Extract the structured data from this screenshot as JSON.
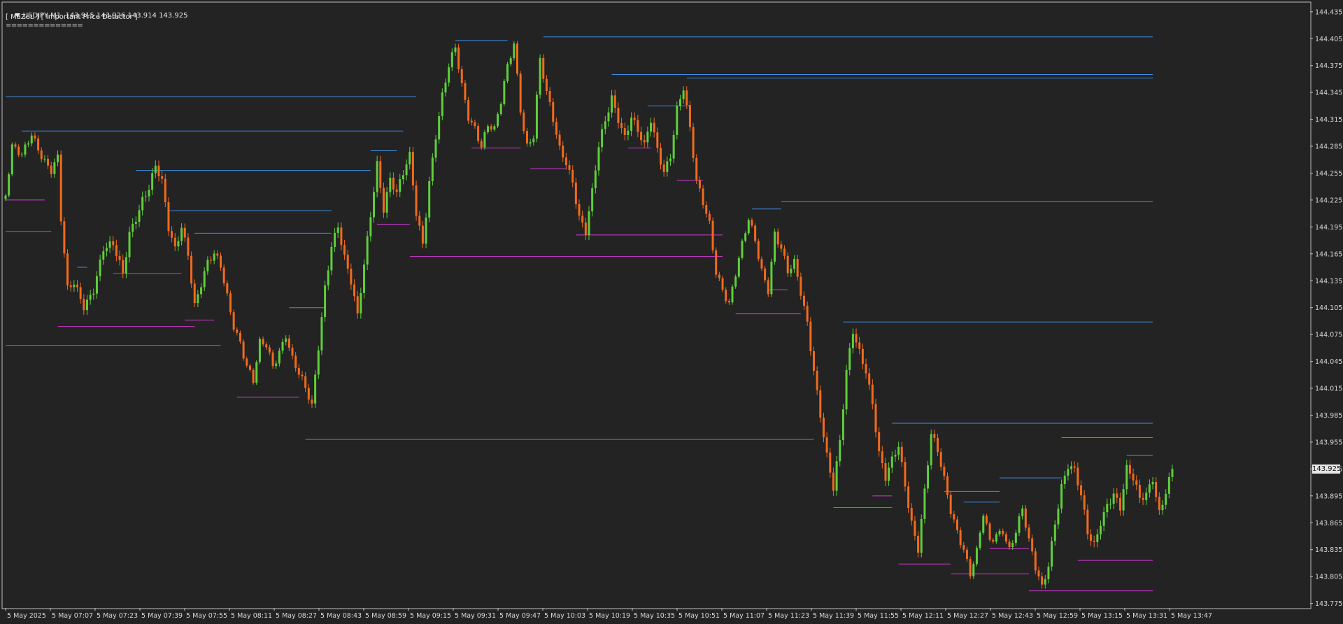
{
  "header": {
    "symbol_line": "USDJPY,M1  143.915 143.926 143.914 143.925",
    "indicator_line": "[ MaZeL ] [ Important Price Detactor ]",
    "separator_line": "=============="
  },
  "icons": {
    "collapse": "triangle-down-icon"
  },
  "colors": {
    "background": "#232323",
    "bull": "#5fcf3a",
    "bear": "#f26a1b",
    "resistance": "#3d8fe6",
    "support": "#d23ad8",
    "axis": "#bdbdbd",
    "current_price_tag": "#e6e6e6"
  },
  "current_price_label": "143.925",
  "chart_data": {
    "type": "candlestick",
    "symbol": "USDJPY",
    "timeframe": "M1",
    "last_quote": {
      "open": 143.915,
      "high": 143.926,
      "low": 143.914,
      "close": 143.925
    },
    "ylim": [
      143.77,
      144.445
    ],
    "y_ticks": [
      "144.435",
      "144.405",
      "144.375",
      "144.345",
      "144.315",
      "144.285",
      "144.255",
      "144.225",
      "144.195",
      "144.165",
      "144.135",
      "144.105",
      "144.075",
      "144.045",
      "144.015",
      "143.985",
      "143.955",
      "143.925",
      "143.895",
      "143.865",
      "143.835",
      "143.805",
      "143.775"
    ],
    "x_ticks": [
      "5 May 2025",
      "5 May 07:07",
      "5 May 07:23",
      "5 May 07:39",
      "5 May 07:55",
      "5 May 08:11",
      "5 May 08:27",
      "5 May 08:43",
      "5 May 08:59",
      "5 May 09:15",
      "5 May 09:31",
      "5 May 09:47",
      "5 May 10:03",
      "5 May 10:19",
      "5 May 10:35",
      "5 May 10:51",
      "5 May 11:07",
      "5 May 11:23",
      "5 May 11:39",
      "5 May 11:55",
      "5 May 12:11",
      "5 May 12:27",
      "5 May 12:43",
      "5 May 12:59",
      "5 May 13:15",
      "5 May 13:31",
      "5 May 13:47"
    ],
    "grid": false,
    "price_path": [
      [
        0,
        144.23
      ],
      [
        2,
        144.28
      ],
      [
        5,
        144.27
      ],
      [
        8,
        144.3
      ],
      [
        11,
        144.28
      ],
      [
        14,
        144.26
      ],
      [
        16,
        144.27
      ],
      [
        17,
        144.2
      ],
      [
        19,
        144.12
      ],
      [
        21,
        144.13
      ],
      [
        24,
        144.11
      ],
      [
        27,
        144.13
      ],
      [
        30,
        144.17
      ],
      [
        33,
        144.17
      ],
      [
        36,
        144.14
      ],
      [
        38,
        144.19
      ],
      [
        40,
        144.21
      ],
      [
        42,
        144.23
      ],
      [
        44,
        144.24
      ],
      [
        46,
        144.26
      ],
      [
        48,
        144.24
      ],
      [
        50,
        144.19
      ],
      [
        52,
        144.17
      ],
      [
        54,
        144.2
      ],
      [
        56,
        144.17
      ],
      [
        58,
        144.11
      ],
      [
        60,
        144.13
      ],
      [
        62,
        144.15
      ],
      [
        64,
        144.16
      ],
      [
        66,
        144.15
      ],
      [
        68,
        144.12
      ],
      [
        70,
        144.09
      ],
      [
        72,
        144.07
      ],
      [
        74,
        144.04
      ],
      [
        76,
        144.02
      ],
      [
        78,
        144.06
      ],
      [
        80,
        144.06
      ],
      [
        82,
        144.04
      ],
      [
        84,
        144.06
      ],
      [
        86,
        144.08
      ],
      [
        88,
        144.05
      ],
      [
        90,
        144.03
      ],
      [
        92,
        144.01
      ],
      [
        94,
        143.99
      ],
      [
        96,
        144.06
      ],
      [
        98,
        144.13
      ],
      [
        100,
        144.18
      ],
      [
        102,
        144.2
      ],
      [
        104,
        144.16
      ],
      [
        106,
        144.13
      ],
      [
        108,
        144.09
      ],
      [
        110,
        144.15
      ],
      [
        112,
        144.21
      ],
      [
        114,
        144.27
      ],
      [
        116,
        144.22
      ],
      [
        118,
        144.25
      ],
      [
        120,
        144.23
      ],
      [
        122,
        144.25
      ],
      [
        124,
        144.27
      ],
      [
        126,
        144.21
      ],
      [
        128,
        144.18
      ],
      [
        130,
        144.25
      ],
      [
        132,
        144.3
      ],
      [
        134,
        144.34
      ],
      [
        136,
        144.37
      ],
      [
        138,
        144.39
      ],
      [
        140,
        144.35
      ],
      [
        142,
        144.32
      ],
      [
        144,
        144.31
      ],
      [
        146,
        144.29
      ],
      [
        148,
        144.31
      ],
      [
        150,
        144.3
      ],
      [
        152,
        144.33
      ],
      [
        154,
        144.37
      ],
      [
        156,
        144.4
      ],
      [
        158,
        144.33
      ],
      [
        160,
        144.29
      ],
      [
        162,
        144.3
      ],
      [
        164,
        144.38
      ],
      [
        166,
        144.34
      ],
      [
        168,
        144.31
      ],
      [
        170,
        144.28
      ],
      [
        172,
        144.27
      ],
      [
        174,
        144.25
      ],
      [
        176,
        144.21
      ],
      [
        178,
        144.19
      ],
      [
        180,
        144.23
      ],
      [
        182,
        144.28
      ],
      [
        184,
        144.31
      ],
      [
        186,
        144.34
      ],
      [
        188,
        144.32
      ],
      [
        190,
        144.3
      ],
      [
        192,
        144.32
      ],
      [
        194,
        144.3
      ],
      [
        196,
        144.28
      ],
      [
        198,
        144.31
      ],
      [
        200,
        144.28
      ],
      [
        202,
        144.26
      ],
      [
        204,
        144.28
      ],
      [
        206,
        144.33
      ],
      [
        208,
        144.35
      ],
      [
        210,
        144.3
      ],
      [
        212,
        144.24
      ],
      [
        214,
        144.22
      ],
      [
        216,
        144.2
      ],
      [
        218,
        144.15
      ],
      [
        220,
        144.13
      ],
      [
        222,
        144.11
      ],
      [
        224,
        144.14
      ],
      [
        226,
        144.17
      ],
      [
        228,
        144.2
      ],
      [
        230,
        144.18
      ],
      [
        232,
        144.15
      ],
      [
        234,
        144.13
      ],
      [
        236,
        144.19
      ],
      [
        238,
        144.17
      ],
      [
        240,
        144.14
      ],
      [
        242,
        144.15
      ],
      [
        244,
        144.12
      ],
      [
        246,
        144.09
      ],
      [
        248,
        144.04
      ],
      [
        250,
        143.99
      ],
      [
        252,
        143.94
      ],
      [
        254,
        143.9
      ],
      [
        256,
        143.95
      ],
      [
        258,
        144.03
      ],
      [
        260,
        144.08
      ],
      [
        262,
        144.06
      ],
      [
        264,
        144.04
      ],
      [
        266,
        144.0
      ],
      [
        268,
        143.94
      ],
      [
        270,
        143.91
      ],
      [
        272,
        143.93
      ],
      [
        274,
        143.95
      ],
      [
        276,
        143.91
      ],
      [
        278,
        143.87
      ],
      [
        280,
        143.84
      ],
      [
        282,
        143.9
      ],
      [
        284,
        143.96
      ],
      [
        286,
        143.94
      ],
      [
        288,
        143.91
      ],
      [
        290,
        143.88
      ],
      [
        292,
        143.86
      ],
      [
        294,
        143.84
      ],
      [
        296,
        143.81
      ],
      [
        298,
        143.83
      ],
      [
        300,
        143.87
      ],
      [
        302,
        143.84
      ],
      [
        304,
        143.85
      ],
      [
        306,
        143.86
      ],
      [
        308,
        143.84
      ],
      [
        310,
        143.86
      ],
      [
        312,
        143.88
      ],
      [
        314,
        143.84
      ],
      [
        316,
        143.81
      ],
      [
        318,
        143.79
      ],
      [
        320,
        143.82
      ],
      [
        322,
        143.87
      ],
      [
        324,
        143.91
      ],
      [
        326,
        143.93
      ],
      [
        328,
        143.92
      ],
      [
        330,
        143.89
      ],
      [
        332,
        143.85
      ],
      [
        334,
        143.84
      ],
      [
        336,
        143.87
      ],
      [
        338,
        143.89
      ],
      [
        340,
        143.9
      ],
      [
        342,
        143.88
      ],
      [
        344,
        143.92
      ],
      [
        346,
        143.91
      ],
      [
        348,
        143.89
      ],
      [
        350,
        143.9
      ],
      [
        352,
        143.92
      ],
      [
        354,
        143.88
      ],
      [
        356,
        143.9
      ],
      [
        358,
        143.92
      ]
    ],
    "resistance_levels": [
      {
        "price": 144.34,
        "from": 0,
        "to": 126
      },
      {
        "price": 144.302,
        "from": 5,
        "to": 122
      },
      {
        "price": 144.28,
        "from": 112,
        "to": 120
      },
      {
        "price": 144.258,
        "from": 40,
        "to": 112
      },
      {
        "price": 144.213,
        "from": 50,
        "to": 100
      },
      {
        "price": 144.188,
        "from": 58,
        "to": 100
      },
      {
        "price": 144.15,
        "from": 22,
        "to": 25
      },
      {
        "price": 144.105,
        "from": 87,
        "to": 98
      },
      {
        "price": 144.403,
        "from": 138,
        "to": 154
      },
      {
        "price": 144.407,
        "from": 165,
        "to": 352
      },
      {
        "price": 144.365,
        "from": 186,
        "to": 352
      },
      {
        "price": 144.361,
        "from": 209,
        "to": 352
      },
      {
        "price": 144.33,
        "from": 197,
        "to": 210
      },
      {
        "price": 144.215,
        "from": 229,
        "to": 238
      },
      {
        "price": 144.223,
        "from": 238,
        "to": 352
      },
      {
        "price": 144.089,
        "from": 257,
        "to": 352
      },
      {
        "price": 143.976,
        "from": 272,
        "to": 352
      },
      {
        "price": 143.96,
        "from": 324,
        "to": 352
      },
      {
        "price": 143.94,
        "from": 344,
        "to": 352
      },
      {
        "price": 143.915,
        "from": 305,
        "to": 324
      },
      {
        "price": 143.9,
        "from": 288,
        "to": 305
      },
      {
        "price": 143.888,
        "from": 294,
        "to": 305
      }
    ],
    "support_levels": [
      {
        "price": 144.225,
        "from": 0,
        "to": 12
      },
      {
        "price": 144.19,
        "from": 0,
        "to": 14
      },
      {
        "price": 144.143,
        "from": 33,
        "to": 54
      },
      {
        "price": 144.084,
        "from": 16,
        "to": 58
      },
      {
        "price": 144.063,
        "from": 0,
        "to": 66
      },
      {
        "price": 144.091,
        "from": 55,
        "to": 64
      },
      {
        "price": 144.005,
        "from": 71,
        "to": 90
      },
      {
        "price": 143.958,
        "from": 92,
        "to": 248
      },
      {
        "price": 144.198,
        "from": 114,
        "to": 124
      },
      {
        "price": 144.162,
        "from": 124,
        "to": 220
      },
      {
        "price": 144.283,
        "from": 143,
        "to": 158
      },
      {
        "price": 144.26,
        "from": 161,
        "to": 172
      },
      {
        "price": 144.186,
        "from": 175,
        "to": 220
      },
      {
        "price": 144.283,
        "from": 191,
        "to": 198
      },
      {
        "price": 144.247,
        "from": 206,
        "to": 214
      },
      {
        "price": 144.098,
        "from": 224,
        "to": 244
      },
      {
        "price": 144.125,
        "from": 234,
        "to": 240
      },
      {
        "price": 143.882,
        "from": 254,
        "to": 272
      },
      {
        "price": 143.895,
        "from": 266,
        "to": 272
      },
      {
        "price": 143.819,
        "from": 274,
        "to": 290
      },
      {
        "price": 143.808,
        "from": 290,
        "to": 314
      },
      {
        "price": 143.836,
        "from": 302,
        "to": 314
      },
      {
        "price": 143.789,
        "from": 314,
        "to": 352
      },
      {
        "price": 143.823,
        "from": 329,
        "to": 352
      }
    ]
  }
}
